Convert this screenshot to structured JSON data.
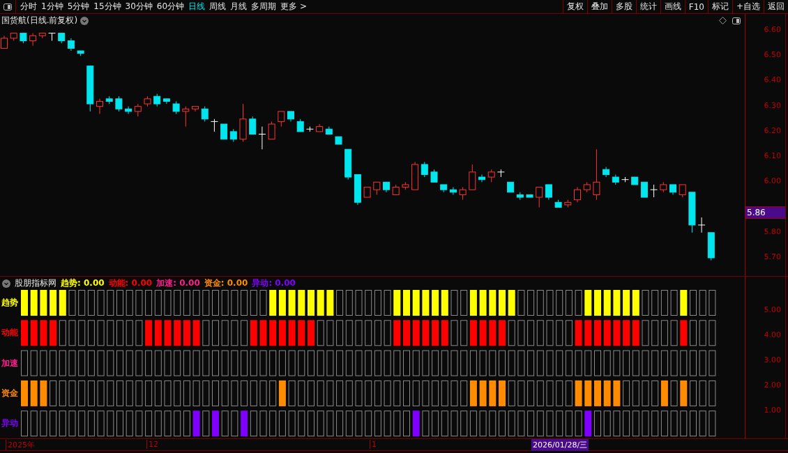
{
  "toolbar": {
    "periods": [
      {
        "label": "分时",
        "selected": false
      },
      {
        "label": "1分钟",
        "selected": false
      },
      {
        "label": "5分钟",
        "selected": false
      },
      {
        "label": "15分钟",
        "selected": false
      },
      {
        "label": "30分钟",
        "selected": false
      },
      {
        "label": "60分钟",
        "selected": false
      },
      {
        "label": "日线",
        "selected": true
      },
      {
        "label": "周线",
        "selected": false
      },
      {
        "label": "月线",
        "selected": false
      },
      {
        "label": "多周期",
        "selected": false
      },
      {
        "label": "更多 >",
        "selected": false
      }
    ],
    "actions": [
      "复权",
      "叠加",
      "多股",
      "统计",
      "画线",
      "F10",
      "标记",
      "+自选",
      "返回"
    ]
  },
  "price_chart": {
    "title": "国货航(日线.前复权)",
    "axis_ticks": [
      "6.60",
      "6.50",
      "6.40",
      "6.30",
      "6.20",
      "6.10",
      "6.00",
      "5.80",
      "5.70"
    ],
    "current_price": "5.86"
  },
  "indicator": {
    "name": "股朋指标网",
    "readouts": [
      {
        "label": "趋势:",
        "value": "0.00"
      },
      {
        "label": "动能:",
        "value": "0.00"
      },
      {
        "label": "加速:",
        "value": "0.00"
      },
      {
        "label": "资金:",
        "value": "0.00"
      },
      {
        "label": "异动:",
        "value": "0.00"
      }
    ],
    "rows": [
      {
        "label": "趋势",
        "color": "#ffff00"
      },
      {
        "label": "动能",
        "color": "#ff0000"
      },
      {
        "label": "加速",
        "color": "#ff1e8c"
      },
      {
        "label": "资金",
        "color": "#ff8c00"
      },
      {
        "label": "异动",
        "color": "#8000ff"
      }
    ],
    "axis_ticks": [
      "5.00",
      "4.00",
      "3.00",
      "2.00",
      "1.00"
    ]
  },
  "date_axis": {
    "labels": [
      "2025年",
      "12",
      "1"
    ],
    "cursor_date": "2026/01/28/三"
  }
}
